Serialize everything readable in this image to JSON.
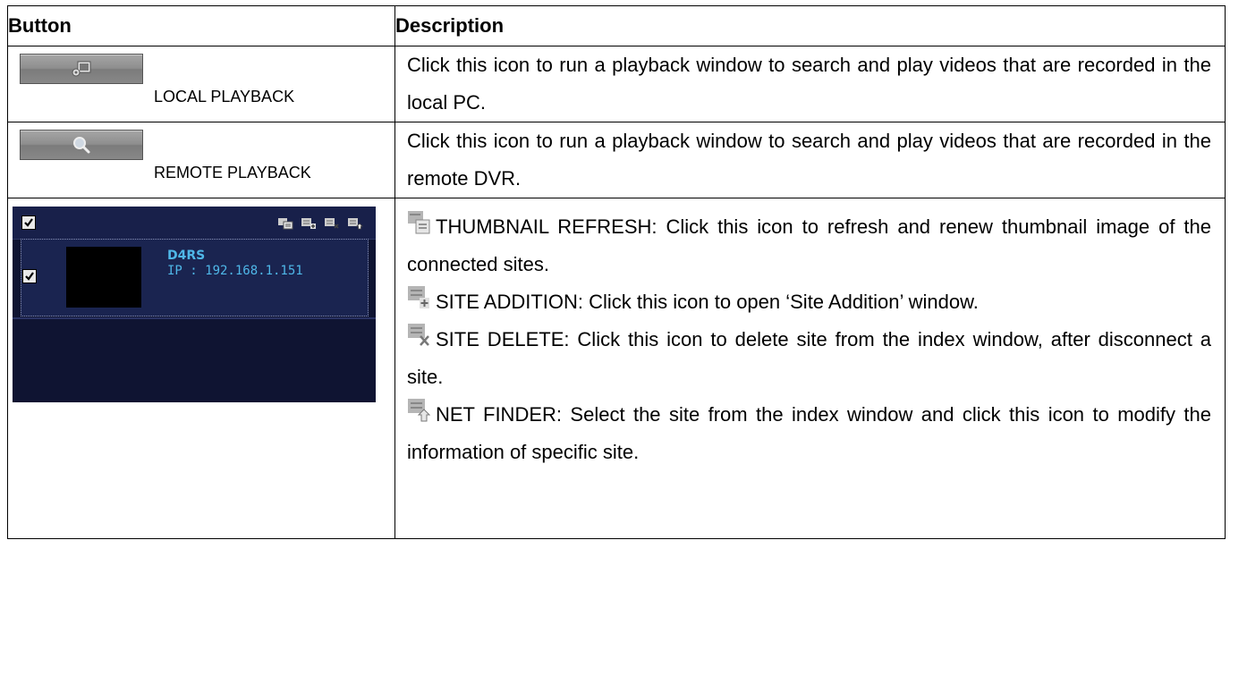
{
  "header": {
    "col_button": "Button",
    "col_description": "Description"
  },
  "rows": [
    {
      "button_icon": "gear-window-icon",
      "button_label": "LOCAL PLAYBACK",
      "description": "Click this icon to run a playback window to search and play videos that are recorded in the local PC."
    },
    {
      "button_icon": "magnifier-icon",
      "button_label": "REMOTE PLAYBACK",
      "description": "Click this icon to run a playback window to search and play videos that are recorded in the remote DVR."
    }
  ],
  "panel": {
    "site_name": "D4RS",
    "site_ip": "IP : 192.168.1.151",
    "background": "#0f1432",
    "text_color": "#4fb7e8"
  },
  "icon_items": [
    {
      "icon": "thumbnail-refresh-icon",
      "text": "THUMBNAIL REFRESH: Click this icon to refresh and renew thumbnail image of the connected sites."
    },
    {
      "icon": "site-addition-icon",
      "text": "SITE ADDITION: Click this icon to open ‘Site Addition’ window."
    },
    {
      "icon": "site-delete-icon",
      "text": "SITE DELETE: Click this icon to delete site from the index window, after disconnect a site."
    },
    {
      "icon": "net-finder-icon",
      "text": "NET FINDER: Select the site from the index window and click this icon to modify the information of specific site."
    }
  ]
}
